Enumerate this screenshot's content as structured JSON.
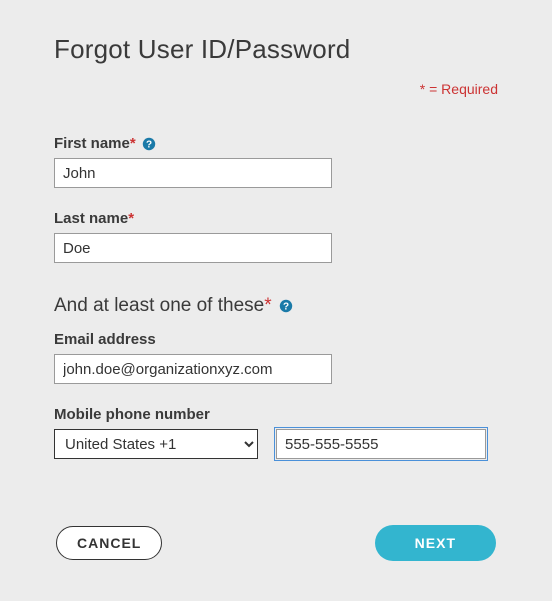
{
  "page": {
    "title": "Forgot User ID/Password",
    "required_note": "* = Required"
  },
  "fields": {
    "first_name": {
      "label": "First name",
      "value": "John",
      "required": "*"
    },
    "last_name": {
      "label": "Last name",
      "value": "Doe",
      "required": "*"
    },
    "email": {
      "label": "Email address",
      "value": "john.doe@organizationxyz.com"
    },
    "phone": {
      "label": "Mobile phone number",
      "country_selected": "United States +1",
      "value": "555-555-5555"
    }
  },
  "section": {
    "at_least_one": "And at least one of these",
    "required": "*"
  },
  "buttons": {
    "cancel": "CANCEL",
    "next": "NEXT"
  },
  "colors": {
    "required": "#cc3333",
    "help_icon": "#1a7aa8",
    "next_button": "#33b5cf"
  }
}
